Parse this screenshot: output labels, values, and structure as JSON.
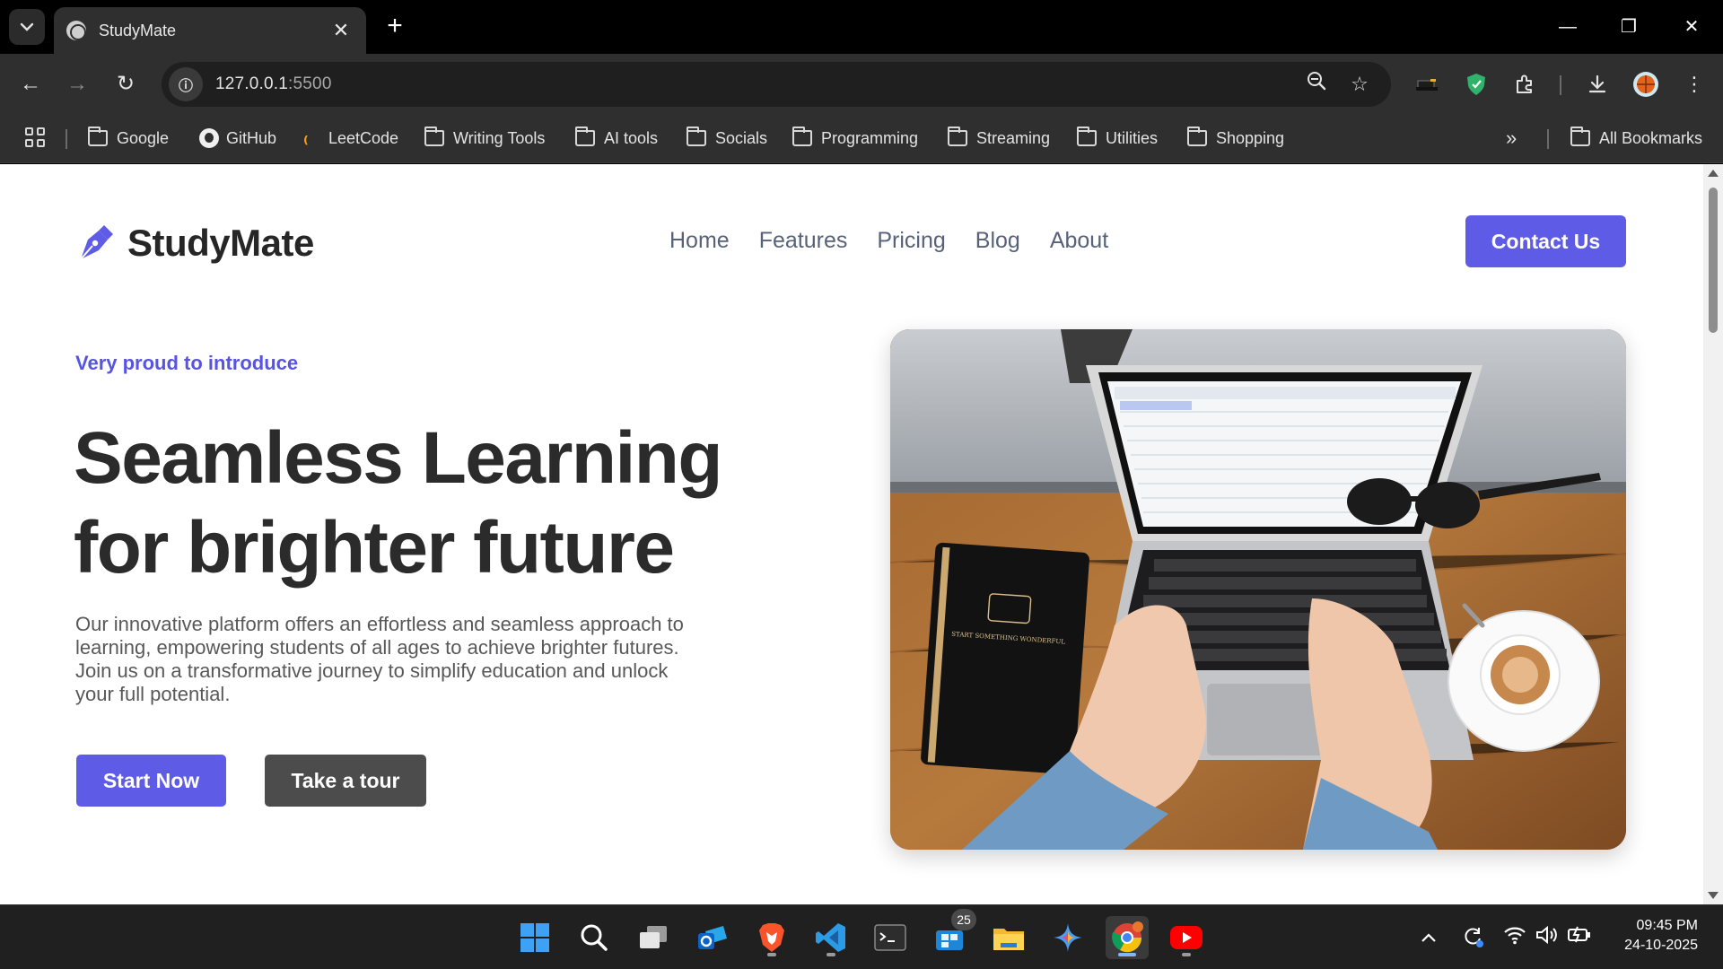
{
  "browser": {
    "tab_title": "StudyMate",
    "url_host": "127.0.0.1",
    "url_port": ":5500",
    "bookmarks": [
      {
        "label": "Google",
        "icon": "folder-icon"
      },
      {
        "label": "GitHub",
        "icon": "github-icon"
      },
      {
        "label": "LeetCode",
        "icon": "leetcode-icon"
      },
      {
        "label": "Writing Tools",
        "icon": "folder-icon"
      },
      {
        "label": "AI tools",
        "icon": "folder-icon"
      },
      {
        "label": "Socials",
        "icon": "folder-icon"
      },
      {
        "label": "Programming",
        "icon": "folder-icon"
      },
      {
        "label": "Streaming",
        "icon": "folder-icon"
      },
      {
        "label": "Utilities",
        "icon": "folder-icon"
      },
      {
        "label": "Shopping",
        "icon": "folder-icon"
      }
    ],
    "all_bookmarks": "All Bookmarks",
    "overflow": "»"
  },
  "page": {
    "brand": "StudyMate",
    "brand_color": "#5e5ce6",
    "nav": [
      "Home",
      "Features",
      "Pricing",
      "Blog",
      "About"
    ],
    "contact_label": "Contact Us",
    "eyebrow": "Very proud to introduce",
    "headline_line1": "Seamless Learning",
    "headline_line2": "for brighter future",
    "lead": "Our innovative platform offers an effortless and seamless approach to learning, empowering students of all ages to achieve brighter futures. Join us on a transformative journey to simplify education and unlock your full potential.",
    "start_label": "Start Now",
    "tour_label": "Take a tour",
    "notebook_text": "START SOMETHING WONDERFUL"
  },
  "taskbar": {
    "apps": [
      "windows-start",
      "search",
      "task-view",
      "outlook",
      "brave",
      "vscode",
      "terminal",
      "store",
      "file-explorer",
      "copilot",
      "chrome",
      "youtube"
    ],
    "store_badge": "25",
    "time": "09:45 PM",
    "date": "24-10-2025"
  }
}
